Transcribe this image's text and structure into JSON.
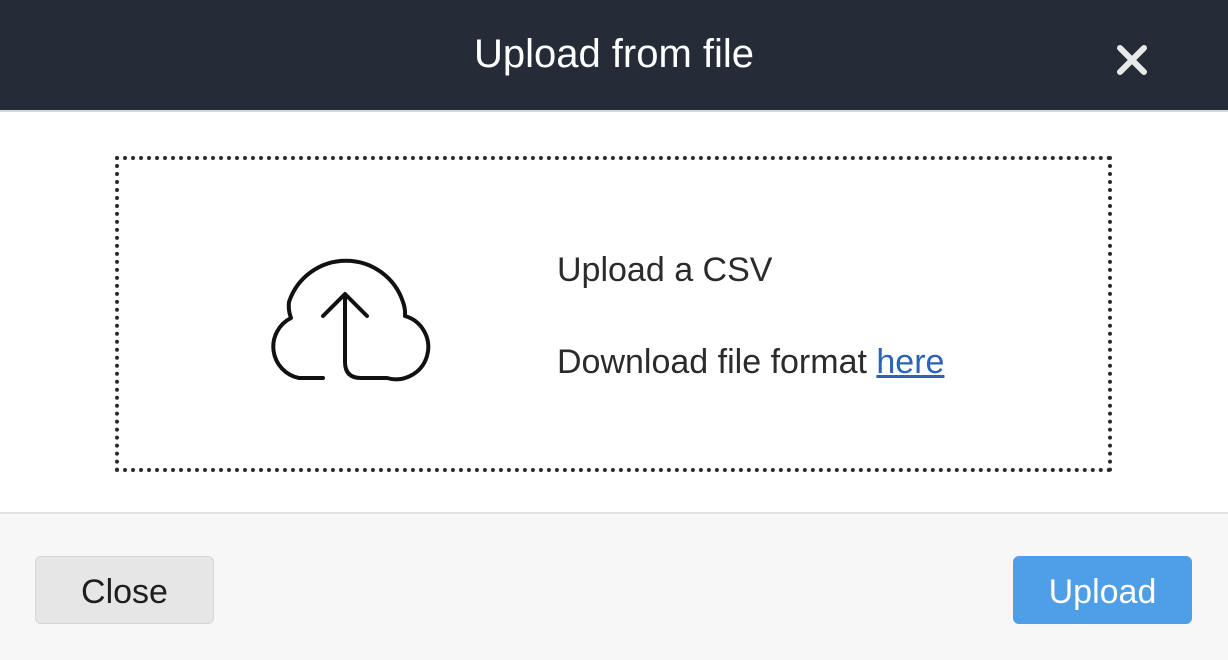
{
  "modal": {
    "title": "Upload from file",
    "close_icon": "close-x-icon"
  },
  "dropzone": {
    "icon": "cloud-upload-icon",
    "primary_text": "Upload a CSV",
    "format_text": "Download file format ",
    "format_link": "here"
  },
  "footer": {
    "close_label": "Close",
    "upload_label": "Upload"
  },
  "colors": {
    "header_bg": "#262c37",
    "upload_button": "#4e9ee8",
    "link": "#2a63b8"
  }
}
